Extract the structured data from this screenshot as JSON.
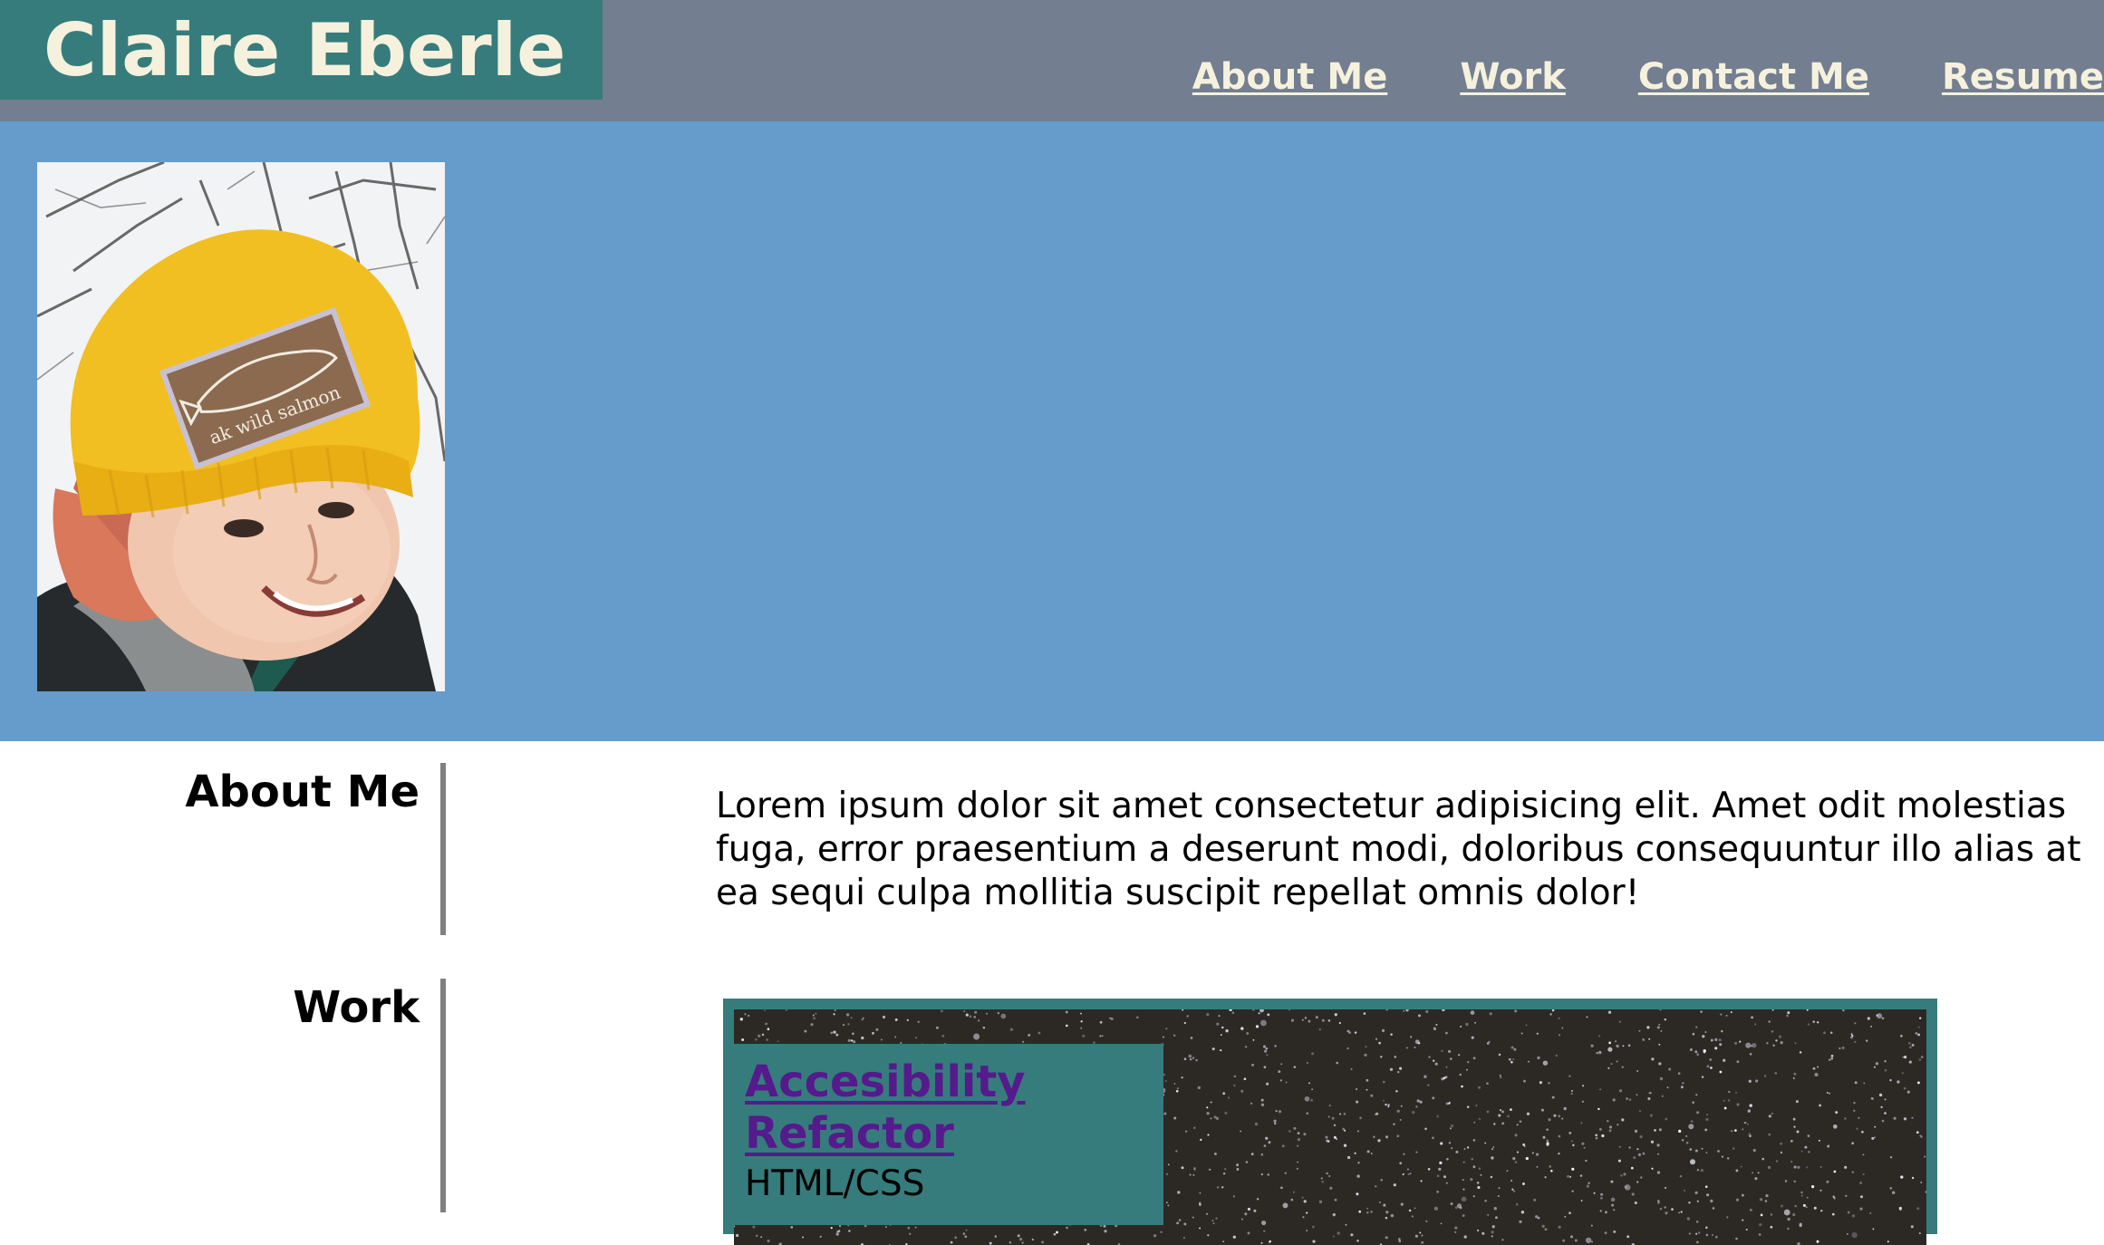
{
  "header": {
    "brand": "Claire Eberle",
    "nav": [
      {
        "label": "About Me"
      },
      {
        "label": "Work"
      },
      {
        "label": "Contact Me"
      },
      {
        "label": "Resume"
      }
    ]
  },
  "hero": {
    "photo_alt": "portrait photo of Claire in a yellow beanie with an ak wild salmon patch",
    "beanie_patch_text": "ak wild salmon"
  },
  "about": {
    "title": "About Me",
    "text": "Lorem ipsum dolor sit amet consectetur adipisicing elit. Amet odit molestias fuga, error praesentium a deserunt modi, doloribus consequuntur illo alias at ea sequi culpa mollitia suscipit repellat omnis dolor!"
  },
  "work": {
    "title": "Work",
    "projects": [
      {
        "title": "Accesibility Refactor",
        "tech": "HTML/CSS"
      }
    ]
  },
  "colors": {
    "header_bg": "#737e90",
    "brand_bg": "#367c7c",
    "brand_text": "#f5f1dc",
    "hero_bg": "#659ccb",
    "link_visited": "#551a8b",
    "divider": "#808080"
  }
}
